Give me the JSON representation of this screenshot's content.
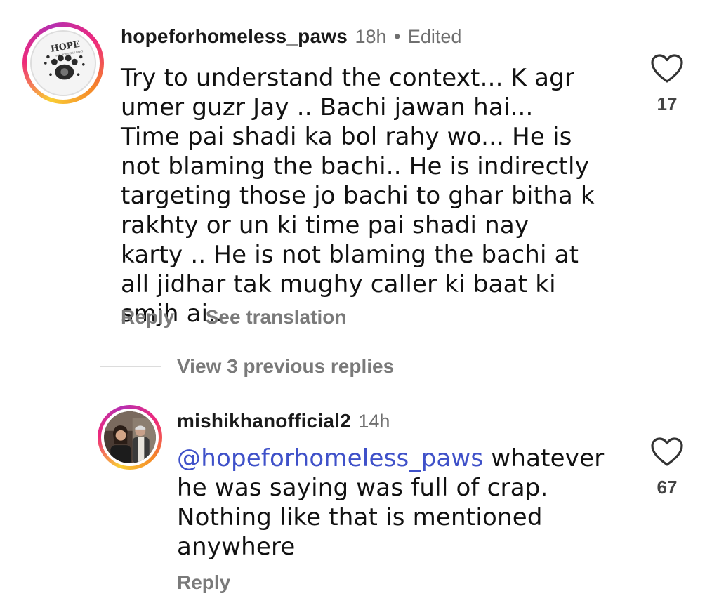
{
  "comment": {
    "username": "hopeforhomeless_paws",
    "time": "18h",
    "separator": "•",
    "edited": "Edited",
    "text": "Try to understand the context... K agr umer guzr Jay .. Bachi jawan hai... Time pai shadi ka bol rahy wo... He is not blaming the bachi.. He is indirectly targeting those jo bachi to ghar bitha k rakhty or un ki time pai shadi nay karty .. He is not blaming the bachi at all jidhar tak mughy caller ki baat ki smjh ai..",
    "likes": "17",
    "reply_label": "Reply",
    "translate_label": "See translation",
    "avatar_logo_text": "HOPE",
    "avatar_logo_sub": "FOR HOMELESS PAWS"
  },
  "view_replies_label": "View 3 previous replies",
  "reply": {
    "username": "mishikhanofficial2",
    "time": "14h",
    "mention": "@hopeforhomeless_paws",
    "text": " whatever he was saying was full of crap. Nothing like that is mentioned anywhere",
    "likes": "67",
    "reply_label": "Reply"
  },
  "colors": {
    "mention": "#3f51c9",
    "secondary_text": "#7a7a7a"
  },
  "icons": {
    "like": "heart-outline-icon",
    "paw": "paw-icon"
  }
}
